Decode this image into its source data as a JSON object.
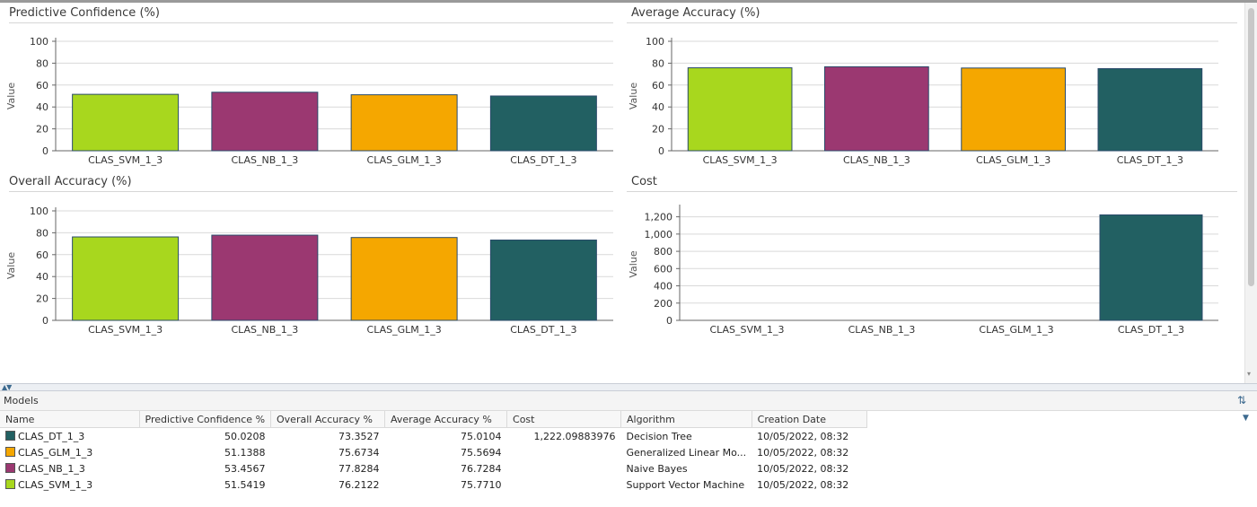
{
  "colors": {
    "svm": "#a8d71e",
    "nb": "#9b3871",
    "glm": "#f5a700",
    "dt": "#226062",
    "grid": "#d9d9d9",
    "axis": "#666666"
  },
  "chart_data": [
    {
      "type": "bar",
      "title": "Predictive Confidence (%)",
      "ylabel": "Value",
      "xlabel": "",
      "categories": [
        "CLAS_SVM_1_3",
        "CLAS_NB_1_3",
        "CLAS_GLM_1_3",
        "CLAS_DT_1_3"
      ],
      "values": [
        51.5419,
        53.4567,
        51.1388,
        50.0208
      ],
      "ylim": [
        0,
        100
      ],
      "yticks": [
        "0",
        "20",
        "40",
        "60",
        "80",
        "100"
      ],
      "ytick_values": [
        0,
        20,
        40,
        60,
        80,
        100
      ],
      "colors": [
        "#a8d71e",
        "#9b3871",
        "#f5a700",
        "#226062"
      ],
      "grid": true
    },
    {
      "type": "bar",
      "title": "Average Accuracy (%)",
      "ylabel": "Value",
      "xlabel": "",
      "categories": [
        "CLAS_SVM_1_3",
        "CLAS_NB_1_3",
        "CLAS_GLM_1_3",
        "CLAS_DT_1_3"
      ],
      "values": [
        75.771,
        76.7284,
        75.5694,
        75.0104
      ],
      "ylim": [
        0,
        100
      ],
      "yticks": [
        "0",
        "20",
        "40",
        "60",
        "80",
        "100"
      ],
      "ytick_values": [
        0,
        20,
        40,
        60,
        80,
        100
      ],
      "colors": [
        "#a8d71e",
        "#9b3871",
        "#f5a700",
        "#226062"
      ],
      "grid": true
    },
    {
      "type": "bar",
      "title": "Overall Accuracy (%)",
      "ylabel": "Value",
      "xlabel": "",
      "categories": [
        "CLAS_SVM_1_3",
        "CLAS_NB_1_3",
        "CLAS_GLM_1_3",
        "CLAS_DT_1_3"
      ],
      "values": [
        76.2122,
        77.8284,
        75.6734,
        73.3527
      ],
      "ylim": [
        0,
        100
      ],
      "yticks": [
        "0",
        "20",
        "40",
        "60",
        "80",
        "100"
      ],
      "ytick_values": [
        0,
        20,
        40,
        60,
        80,
        100
      ],
      "colors": [
        "#a8d71e",
        "#9b3871",
        "#f5a700",
        "#226062"
      ],
      "grid": true
    },
    {
      "type": "bar",
      "title": "Cost",
      "ylabel": "Value",
      "xlabel": "",
      "categories": [
        "CLAS_SVM_1_3",
        "CLAS_NB_1_3",
        "CLAS_GLM_1_3",
        "CLAS_DT_1_3"
      ],
      "values": [
        0,
        0,
        0,
        1222.09883976
      ],
      "ylim": [
        0,
        1300
      ],
      "yticks": [
        "0",
        "200",
        "400",
        "600",
        "800",
        "1,000",
        "1,200"
      ],
      "ytick_values": [
        0,
        200,
        400,
        600,
        800,
        1000,
        1200
      ],
      "colors": [
        "#a8d71e",
        "#9b3871",
        "#f5a700",
        "#226062"
      ],
      "grid": true
    }
  ],
  "models": {
    "title": "Models",
    "columns": [
      "Name",
      "Predictive Confidence %",
      "Overall Accuracy %",
      "Average Accuracy %",
      "Cost",
      "Algorithm",
      "Creation Date"
    ],
    "rows": [
      {
        "name": "CLAS_DT_1_3",
        "color": "#226062",
        "pc": "50.0208",
        "oa": "73.3527",
        "aa": "75.0104",
        "cost": "1,222.09883976",
        "algorithm": "Decision Tree",
        "date": "10/05/2022, 08:32"
      },
      {
        "name": "CLAS_GLM_1_3",
        "color": "#f5a700",
        "pc": "51.1388",
        "oa": "75.6734",
        "aa": "75.5694",
        "cost": "",
        "algorithm": "Generalized Linear Mo...",
        "date": "10/05/2022, 08:32"
      },
      {
        "name": "CLAS_NB_1_3",
        "color": "#9b3871",
        "pc": "53.4567",
        "oa": "77.8284",
        "aa": "76.7284",
        "cost": "",
        "algorithm": "Naive Bayes",
        "date": "10/05/2022, 08:32"
      },
      {
        "name": "CLAS_SVM_1_3",
        "color": "#a8d71e",
        "pc": "51.5419",
        "oa": "76.2122",
        "aa": "75.7710",
        "cost": "",
        "algorithm": "Support Vector Machine",
        "date": "10/05/2022, 08:32"
      }
    ]
  }
}
